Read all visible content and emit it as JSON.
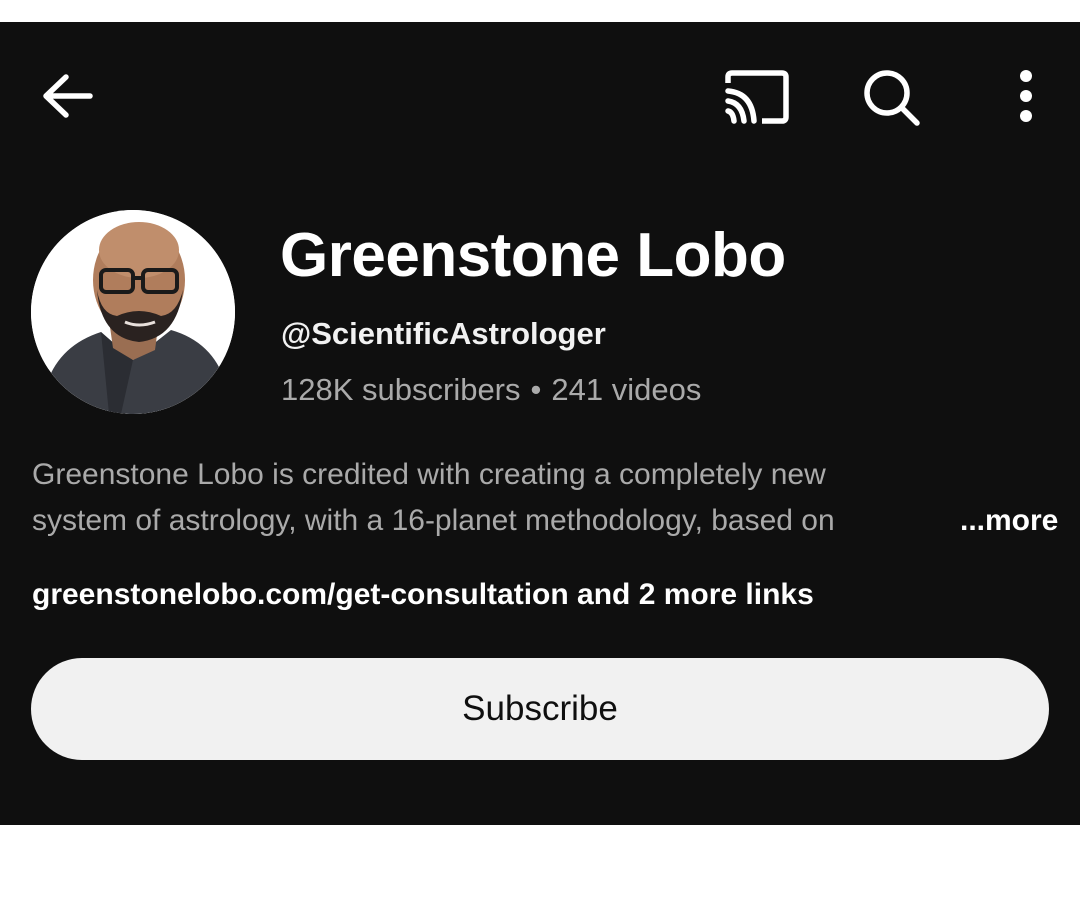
{
  "topbar": {
    "back_icon": "arrow-left-icon",
    "cast_icon": "cast-icon",
    "search_icon": "search-icon",
    "menu_icon": "more-vert-icon"
  },
  "channel": {
    "name": "Greenstone Lobo",
    "handle": "@ScientificAstrologer",
    "subscribers": "128K subscribers",
    "separator": "•",
    "videos": "241 videos",
    "description_line1": "Greenstone Lobo is credited with creating a completely new",
    "description_line2": "system of astrology, with a 16-planet methodology, based on",
    "more_label": "...more",
    "links": "greenstonelobo.com/get-consultation and 2 more links"
  },
  "actions": {
    "subscribe_label": "Subscribe"
  },
  "colors": {
    "background": "#0f0f0f",
    "primary_text": "#ffffff",
    "secondary_text": "#aaaaaa",
    "button_bg": "#f1f1f1",
    "button_text": "#0f0f0f"
  }
}
